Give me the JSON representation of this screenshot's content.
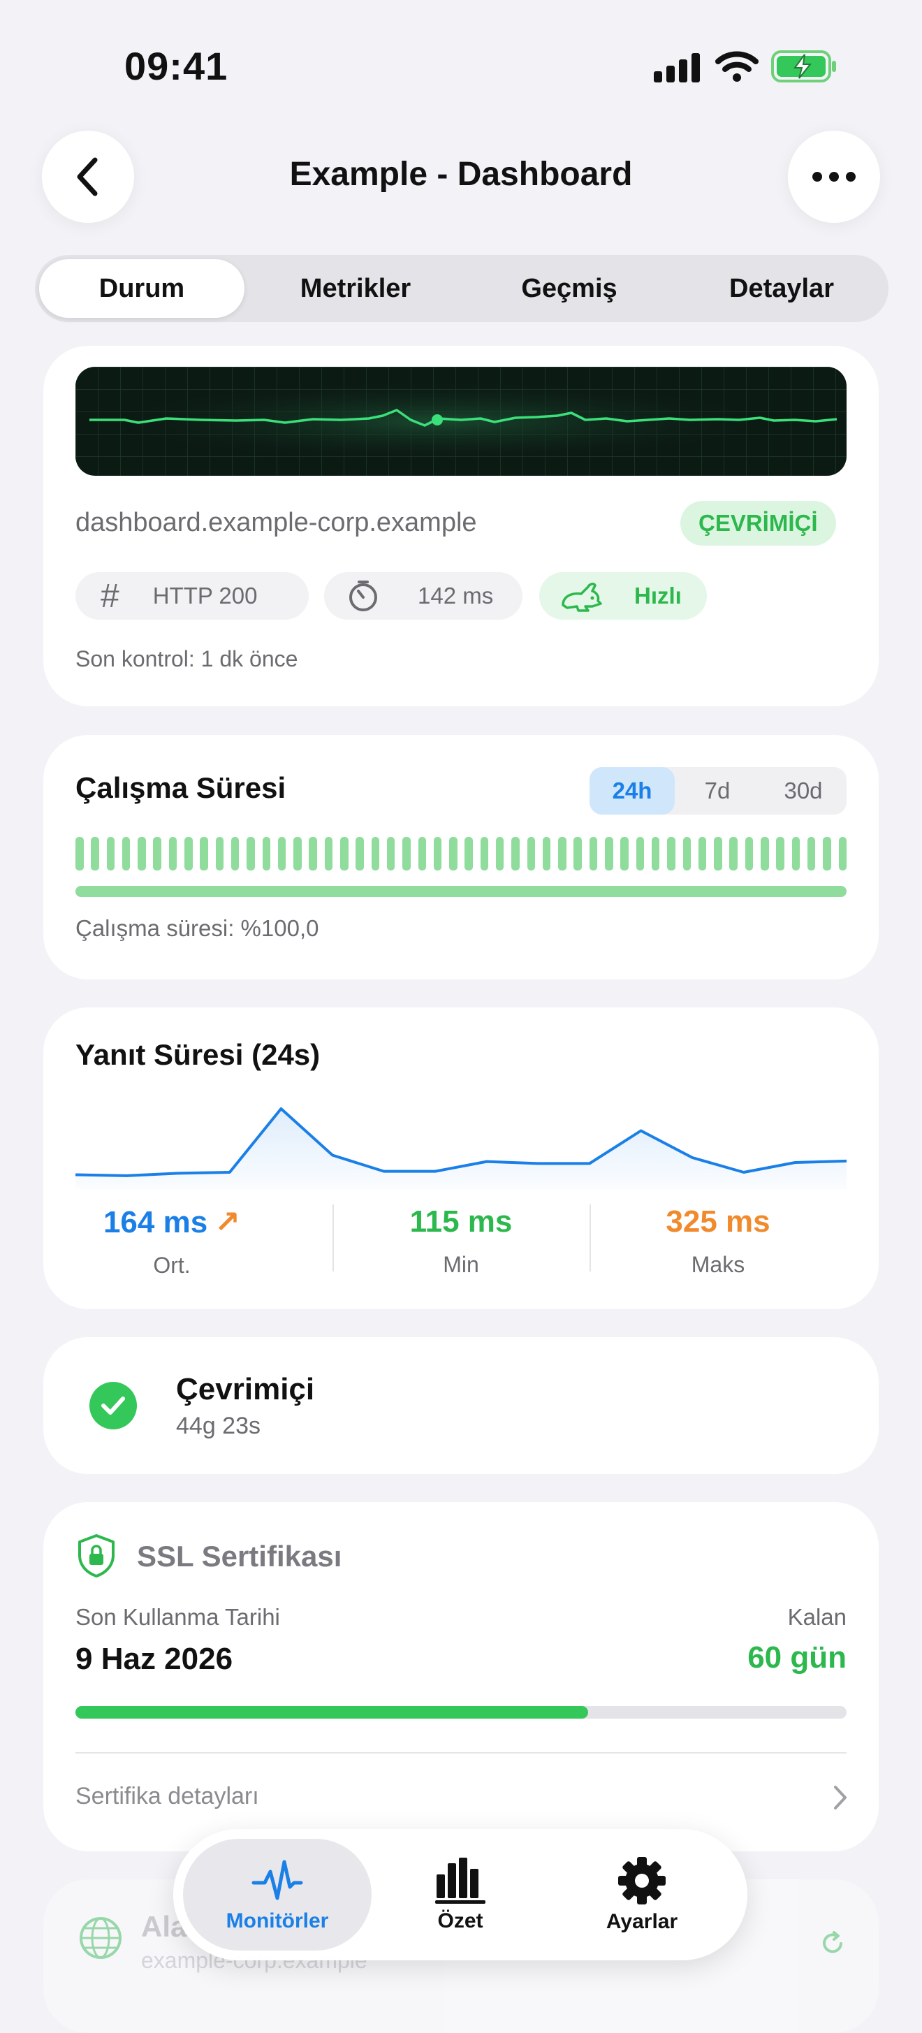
{
  "status_bar": {
    "time": "09:41"
  },
  "nav": {
    "title": "Example - Dashboard"
  },
  "tabs": [
    {
      "label": "Durum",
      "active": true
    },
    {
      "label": "Metrikler",
      "active": false
    },
    {
      "label": "Geçmiş",
      "active": false
    },
    {
      "label": "Detaylar",
      "active": false
    }
  ],
  "status_card": {
    "url": "dashboard.example-corp.example",
    "status_badge": "ÇEVRİMİÇİ",
    "http_code": "HTTP 200",
    "latency": "142 ms",
    "speed_label": "Hızlı",
    "last_check": "Son kontrol: 1 dk önce"
  },
  "uptime_card": {
    "title": "Çalışma Süresi",
    "ranges": [
      "24h",
      "7d",
      "30d"
    ],
    "selected_range": "24h",
    "uptime_percent": 100.0,
    "uptime_text": "Çalışma süresi: %100,0"
  },
  "response_card": {
    "title": "Yanıt Süresi (24s)",
    "chart_data": {
      "type": "area",
      "values": [
        155,
        153,
        158,
        160,
        290,
        195,
        162,
        162,
        182,
        178,
        178,
        245,
        190,
        160,
        180,
        183
      ]
    },
    "stats": [
      {
        "value": "164 ms",
        "label": "Ort.",
        "color": "#1a7fe6",
        "trend": "up"
      },
      {
        "value": "115 ms",
        "label": "Min",
        "color": "#2db84d"
      },
      {
        "value": "325 ms",
        "label": "Maks",
        "color": "#f08a2c"
      }
    ]
  },
  "online_card": {
    "title": "Çevrimiçi",
    "duration": "44g 23s"
  },
  "ssl_card": {
    "title": "SSL Sertifikası",
    "expiry_label": "Son Kullanma Tarihi",
    "expiry_date": "9 Haz 2026",
    "remaining_label": "Kalan",
    "remaining": "60 gün",
    "progress": 0.665,
    "details_link": "Sertifika detayları"
  },
  "peek_card": {
    "title": "Ala",
    "subtitle": "example-corp.example"
  },
  "tab_bar": {
    "items": [
      {
        "label": "Monitörler",
        "icon": "waveform-icon",
        "active": true
      },
      {
        "label": "Özet",
        "icon": "bar-chart-icon",
        "active": false
      },
      {
        "label": "Ayarlar",
        "icon": "gear-icon",
        "active": false
      }
    ]
  },
  "colors": {
    "accent": "#1a7fe6",
    "success": "#2db84d",
    "warning": "#f08a2c",
    "background": "#f2f2f7"
  }
}
